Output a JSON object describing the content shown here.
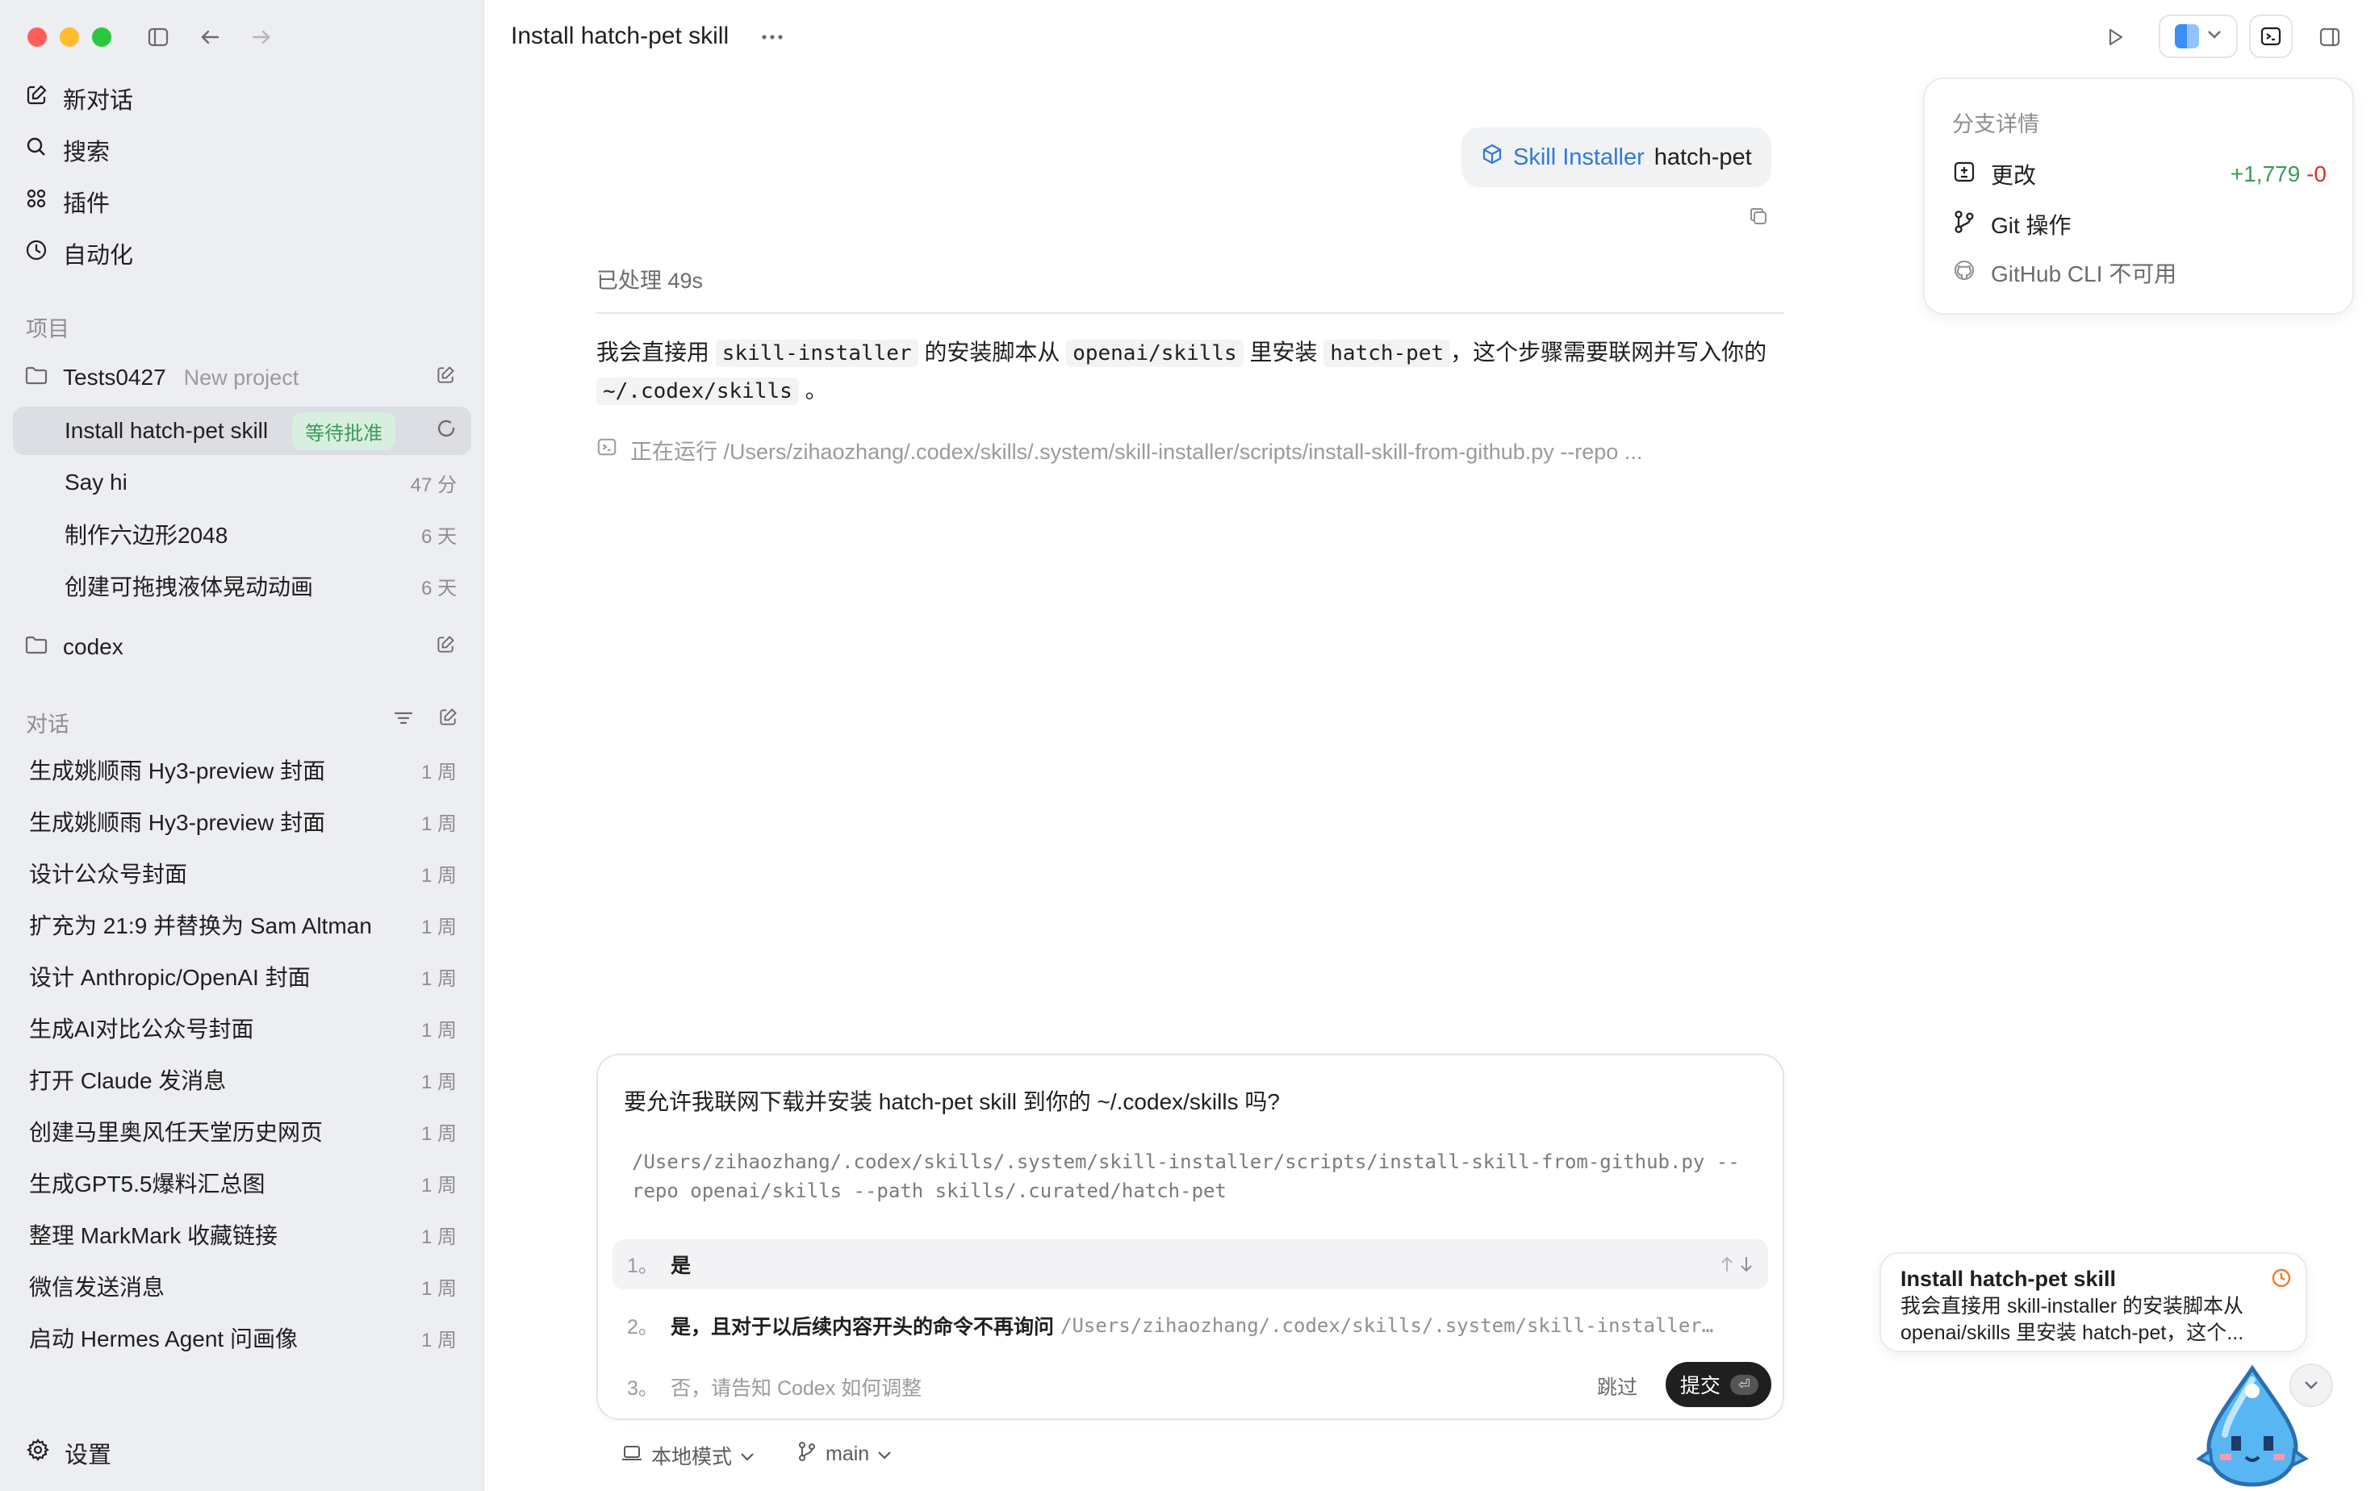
{
  "sidebar": {
    "nav": [
      {
        "label": "新对话",
        "icon": "compose-icon"
      },
      {
        "label": "搜索",
        "icon": "search-icon"
      },
      {
        "label": "插件",
        "icon": "grid-icon"
      },
      {
        "label": "自动化",
        "icon": "clock-icon"
      }
    ],
    "projects_label": "项目",
    "project1": {
      "name": "Tests0427",
      "sub": "New project"
    },
    "project1_threads": [
      {
        "title": "Install hatch-pet skill",
        "badge": "等待批准",
        "time": ""
      },
      {
        "title": "Say hi",
        "time": "47 分"
      },
      {
        "title": "制作六边形2048",
        "time": "6 天"
      },
      {
        "title": "创建可拖拽液体晃动动画",
        "time": "6 天"
      }
    ],
    "project2": {
      "name": "codex"
    },
    "chats_label": "对话",
    "chats": [
      {
        "title": "生成姚顺雨 Hy3-preview 封面",
        "time": "1 周"
      },
      {
        "title": "生成姚顺雨 Hy3-preview 封面",
        "time": "1 周"
      },
      {
        "title": "设计公众号封面",
        "time": "1 周"
      },
      {
        "title": "扩充为 21:9 并替换为 Sam Altman",
        "time": "1 周"
      },
      {
        "title": "设计 Anthropic/OpenAI 封面",
        "time": "1 周"
      },
      {
        "title": "生成AI对比公众号封面",
        "time": "1 周"
      },
      {
        "title": "打开 Claude 发消息",
        "time": "1 周"
      },
      {
        "title": "创建马里奥风任天堂历史网页",
        "time": "1 周"
      },
      {
        "title": "生成GPT5.5爆料汇总图",
        "time": "1 周"
      },
      {
        "title": "整理 MarkMark 收藏链接",
        "time": "1 周"
      },
      {
        "title": "微信发送消息",
        "time": "1 周"
      },
      {
        "title": "启动 Hermes Agent 问画像",
        "time": "1 周"
      }
    ],
    "settings_label": "设置"
  },
  "header": {
    "title": "Install hatch-pet skill"
  },
  "skill_pill": {
    "skill": "Skill Installer",
    "arg": "hatch-pet"
  },
  "processed": "已处理 49s",
  "message": {
    "p1": "我会直接用",
    "c1": "skill-installer",
    "p2": "的安装脚本从",
    "c2": "openai/skills",
    "p3": "里安装",
    "c3": "hatch-pet",
    "p4": "，这个步骤需要联网并写入你的",
    "c4": "~/.codex/skills",
    "p5": "。"
  },
  "running": "正在运行 /Users/zihaozhang/.codex/skills/.system/skill-installer/scripts/install-skill-from-github.py --repo ...",
  "prompt": {
    "question": "要允许我联网下载并安装 hatch-pet skill 到你的 ~/.codex/skills 吗?",
    "command": "/Users/zihaozhang/.codex/skills/.system/skill-installer/scripts/install-skill-from-github.py --repo openai/skills --path skills/.curated/hatch-pet",
    "options": [
      {
        "num": "1。",
        "label": "是"
      },
      {
        "num": "2。",
        "label": "是，且对于以后续内容开头的命令不再询问",
        "extra": "/Users/zihaozhang/.codex/skills/.system/skill-installer…"
      },
      {
        "num": "3。",
        "label": "否，请告知 Codex 如何调整"
      }
    ],
    "skip": "跳过",
    "submit": "提交",
    "submit_key": "⏎"
  },
  "footer": {
    "mode": "本地模式",
    "branch": "main"
  },
  "branch_panel": {
    "title": "分支详情",
    "changes_label": "更改",
    "added": "+1,779",
    "removed": "-0",
    "git_label": "Git 操作",
    "gh_label": "GitHub CLI 不可用"
  },
  "notification": {
    "title": "Install hatch-pet skill",
    "body": "我会直接用 skill-installer 的安装脚本从 openai/skills 里安装 hatch-pet，这个..."
  },
  "colors": {
    "accent_blue": "#2f7bd9",
    "green": "#3a9a5b",
    "red": "#d93025",
    "badge_bg": "#d8efdf",
    "orange": "#f07b2a"
  }
}
